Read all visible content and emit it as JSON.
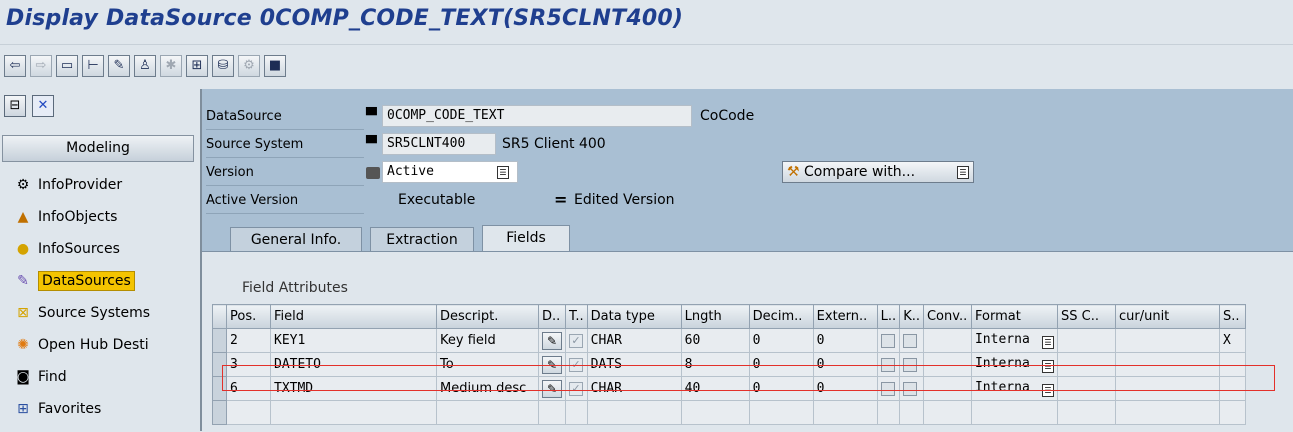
{
  "window": {
    "title": "Display DataSource 0COMP_CODE_TEXT(SR5CLNT400)"
  },
  "toolbar": {
    "buttons": [
      "back-icon",
      "forward-icon",
      "display-icon",
      "hierarchy-icon",
      "where-used-icon",
      "activate-icon",
      "check-icon",
      "transfer-icon",
      "database-icon",
      "settings-icon",
      "info-icon"
    ]
  },
  "sidebar": {
    "modeling_label": "Modeling",
    "items": [
      {
        "label": "InfoProvider",
        "icon": "infoprovider-icon"
      },
      {
        "label": "InfoObjects",
        "icon": "infoobjects-icon"
      },
      {
        "label": "InfoSources",
        "icon": "infosources-icon"
      },
      {
        "label": "DataSources",
        "icon": "datasources-icon",
        "selected": true
      },
      {
        "label": "Source Systems",
        "icon": "source-systems-icon"
      },
      {
        "label": "Open Hub Desti",
        "icon": "open-hub-icon"
      },
      {
        "label": "Find",
        "icon": "find-icon"
      },
      {
        "label": "Favorites",
        "icon": "favorites-icon"
      }
    ]
  },
  "header": {
    "datasource_label": "DataSource",
    "datasource_value": "0COMP_CODE_TEXT",
    "datasource_desc": "CoCode",
    "source_system_label": "Source System",
    "source_system_value": "SR5CLNT400",
    "source_system_desc": "SR5 Client 400",
    "version_label": "Version",
    "version_value": "Active",
    "compare_button": "Compare with...",
    "active_version_label": "Active Version",
    "active_version_value": "Executable",
    "edited_version_symbol": "=",
    "edited_version_label": "Edited Version"
  },
  "tabs": [
    {
      "label": "General Info.",
      "active": false
    },
    {
      "label": "Extraction",
      "active": false
    },
    {
      "label": "Fields",
      "active": true
    }
  ],
  "fields": {
    "section_title": "Field Attributes",
    "columns": [
      "Pos.",
      "Field",
      "Descript.",
      "D..",
      "T..",
      "Data type",
      "Lngth",
      "Decim..",
      "Extern..",
      "L..",
      "K..",
      "Conv..",
      "Format",
      "SS C..",
      "cur/unit",
      "S.."
    ],
    "rows": [
      {
        "pos": "2",
        "field": "KEY1",
        "descr": "Key field",
        "data_type": "CHAR",
        "length": "60",
        "decimals": "0",
        "external": "0",
        "format": "Interna",
        "s": "X"
      },
      {
        "pos": "3",
        "field": "DATETO",
        "descr": "To",
        "data_type": "DATS",
        "length": "8",
        "decimals": "0",
        "external": "0",
        "format": "Interna",
        "s": ""
      },
      {
        "pos": "6",
        "field": "TXTMD",
        "descr": "Medium desc",
        "data_type": "CHAR",
        "length": "40",
        "decimals": "0",
        "external": "0",
        "format": "Interna",
        "s": ""
      }
    ]
  },
  "colors": {
    "selection_highlight": "#f4c400",
    "red_frame": "#e3302a",
    "title_blue": "#1f3f8f"
  }
}
